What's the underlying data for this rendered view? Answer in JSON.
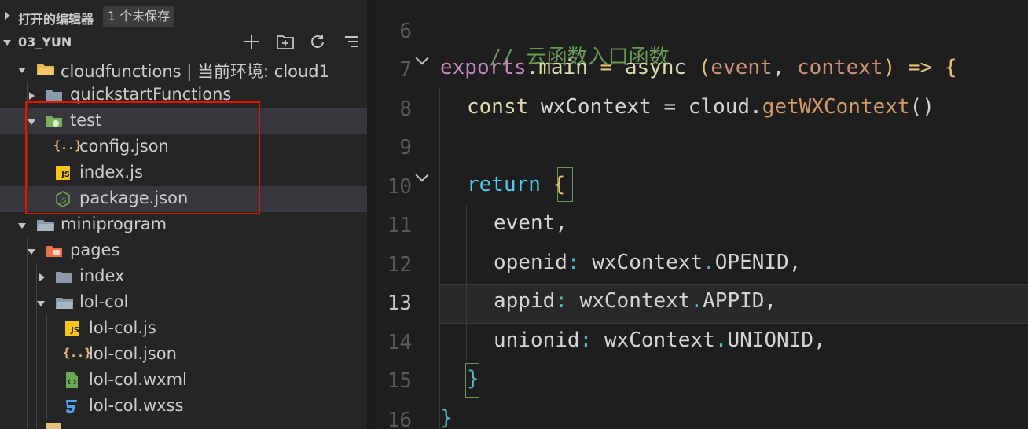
{
  "sidebar": {
    "open_editors": {
      "title": "打开的编辑器",
      "badge": "1 个未保存"
    },
    "project": {
      "name": "03_YUN"
    },
    "tree": [
      {
        "label": "cloudfunctions | 当前环境: cloud1",
        "icon": "folder-open-icon"
      },
      {
        "label": "quickstartFunctions",
        "icon": "folder-icon"
      },
      {
        "label": "test",
        "icon": "cloud-folder-icon"
      },
      {
        "label": "config.json",
        "icon": "json-icon"
      },
      {
        "label": "index.js",
        "icon": "js-icon"
      },
      {
        "label": "package.json",
        "icon": "node-icon"
      },
      {
        "label": "miniprogram",
        "icon": "folder-open-icon"
      },
      {
        "label": "pages",
        "icon": "pages-folder-icon"
      },
      {
        "label": "index",
        "icon": "folder-icon"
      },
      {
        "label": "lol-col",
        "icon": "folder-open-icon"
      },
      {
        "label": "lol-col.js",
        "icon": "js-icon"
      },
      {
        "label": "lol-col.json",
        "icon": "json-icon"
      },
      {
        "label": "lol-col.wxml",
        "icon": "wxml-icon"
      },
      {
        "label": "lol-col.wxss",
        "icon": "css-icon"
      }
    ]
  },
  "editor": {
    "active_line": "13",
    "lines": [
      {
        "num": "6",
        "tokens": [
          "// 云函数入口函数"
        ]
      },
      {
        "num": "7",
        "tokens": [
          "exports",
          ".",
          "main",
          " = ",
          "async",
          " (",
          "event",
          ", ",
          "context",
          ") => {"
        ]
      },
      {
        "num": "8",
        "tokens": [
          "const",
          " wxContext = ",
          "cloud",
          ".",
          "getWXContext",
          "()"
        ]
      },
      {
        "num": "9",
        "tokens": []
      },
      {
        "num": "10",
        "tokens": [
          "return",
          " {"
        ]
      },
      {
        "num": "11",
        "tokens": [
          "event",
          ","
        ]
      },
      {
        "num": "12",
        "tokens": [
          "openid",
          ": ",
          "wxContext",
          ".",
          "OPENID",
          ","
        ]
      },
      {
        "num": "13",
        "tokens": [
          "appid",
          ": ",
          "wxContext",
          ".",
          "APPID",
          ","
        ]
      },
      {
        "num": "14",
        "tokens": [
          "unionid",
          ": ",
          "wxContext",
          ".",
          "UNIONID",
          ","
        ]
      },
      {
        "num": "15",
        "tokens": [
          "}"
        ]
      },
      {
        "num": "16",
        "tokens": [
          "}"
        ]
      }
    ]
  },
  "colors": {
    "selection_box": "#e51400",
    "comment": "#6a9955"
  }
}
